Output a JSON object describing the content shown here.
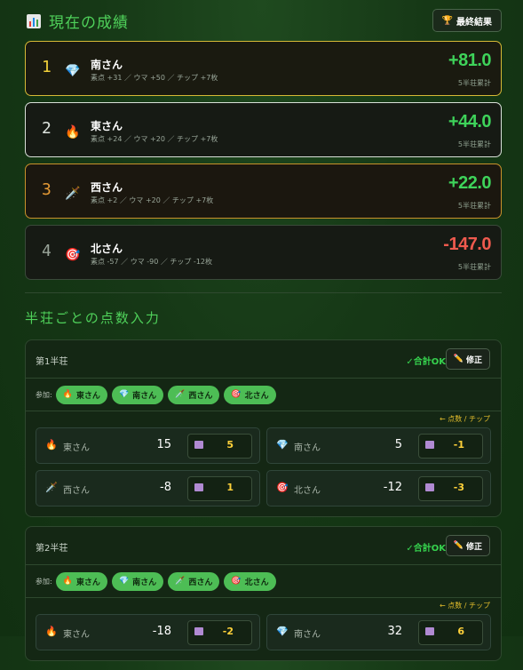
{
  "header": {
    "title": "現在の成績",
    "title_icon": "bar-chart-icon",
    "final_button": "最終結果",
    "final_icon": "trophy-icon"
  },
  "standings": [
    {
      "rank": "1",
      "name": "南さん",
      "icon": "💎",
      "detail": "素点 +31 ／ ウマ +50 ／ チップ +7枚",
      "total": "+81.0",
      "sub": "5半荘累計",
      "sign": "pos"
    },
    {
      "rank": "2",
      "name": "東さん",
      "icon": "🔥",
      "detail": "素点 +24 ／ ウマ +20 ／ チップ +7枚",
      "total": "+44.0",
      "sub": "5半荘累計",
      "sign": "pos"
    },
    {
      "rank": "3",
      "name": "西さん",
      "icon": "🗡️",
      "detail": "素点 +2 ／ ウマ +20 ／ チップ +7枚",
      "total": "+22.0",
      "sub": "5半荘累計",
      "sign": "pos"
    },
    {
      "rank": "4",
      "name": "北さん",
      "icon": "🎯",
      "detail": "素点 -57 ／ ウマ -90 ／ チップ -12枚",
      "total": "-147.0",
      "sub": "5半荘累計",
      "sign": "neg"
    }
  ],
  "section_title": "半荘ごとの点数入力",
  "hanchans": [
    {
      "title": "第1半荘",
      "ok": "✓合計OK",
      "edit": "修正",
      "participants_label": "参加:",
      "participants": [
        {
          "icon": "🔥",
          "name": "東さん"
        },
        {
          "icon": "💎",
          "name": "南さん"
        },
        {
          "icon": "🗡️",
          "name": "西さん"
        },
        {
          "icon": "🎯",
          "name": "北さん"
        }
      ],
      "legend": "← 点数 / チップ",
      "rows": [
        {
          "icon": "🔥",
          "name": "東さん",
          "score": "15",
          "chip": "5"
        },
        {
          "icon": "💎",
          "name": "南さん",
          "score": "5",
          "chip": "-1"
        },
        {
          "icon": "🗡️",
          "name": "西さん",
          "score": "-8",
          "chip": "1"
        },
        {
          "icon": "🎯",
          "name": "北さん",
          "score": "-12",
          "chip": "-3"
        }
      ]
    },
    {
      "title": "第2半荘",
      "ok": "✓合計OK",
      "edit": "修正",
      "participants_label": "参加:",
      "participants": [
        {
          "icon": "🔥",
          "name": "東さん"
        },
        {
          "icon": "💎",
          "name": "南さん"
        },
        {
          "icon": "🗡️",
          "name": "西さん"
        },
        {
          "icon": "🎯",
          "name": "北さん"
        }
      ],
      "legend": "← 点数 / チップ",
      "rows": [
        {
          "icon": "🔥",
          "name": "東さん",
          "score": "-18",
          "chip": "-2"
        },
        {
          "icon": "💎",
          "name": "南さん",
          "score": "32",
          "chip": "6"
        }
      ]
    }
  ]
}
